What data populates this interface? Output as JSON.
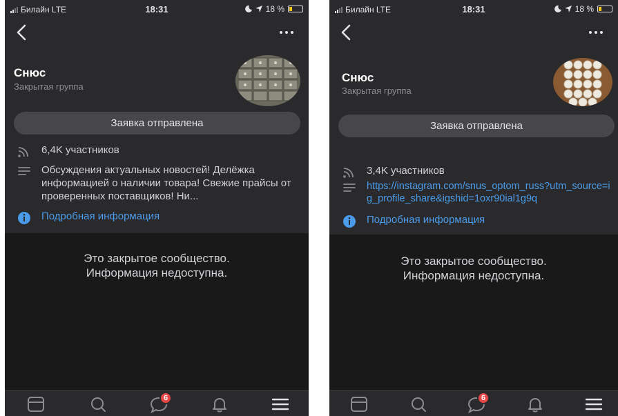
{
  "colors": {
    "background": "#2a2a2c",
    "closed_area": "#19191a",
    "link": "#4a9bea",
    "badge": "#e64646",
    "button": "#474749",
    "battery": "#f5c518"
  },
  "phones": [
    {
      "status": {
        "carrier": "Билайн  LTE",
        "time": "18:31",
        "battery": "18 %",
        "battery_level_percent": 18
      },
      "group": {
        "name": "Снюс",
        "type": "Закрытая группа"
      },
      "request_button": "Заявка отправлена",
      "members": "6,4K участников",
      "description": "Обсуждения актуальных новостей! Делёжка информацией о наличии товара! Свежие прайсы от проверенных поставщиков! Ни...",
      "details_link": "Подробная информация",
      "closed_message": [
        "Это закрытое сообщество.",
        "Информация недоступна."
      ],
      "tabbar": {
        "messages_badge": "6"
      },
      "icons": [
        "back-icon",
        "more-icon",
        "rss-icon",
        "description-icon",
        "info-icon",
        "news-tab-icon",
        "search-tab-icon",
        "messages-tab-icon",
        "notifications-tab-icon",
        "menu-tab-icon"
      ]
    },
    {
      "status": {
        "carrier": "Билайн  LTE",
        "time": "18:31",
        "battery": "18 %",
        "battery_level_percent": 18
      },
      "group": {
        "name": "Снюс",
        "type": "Закрытая группа"
      },
      "request_button": "Заявка отправлена",
      "members": "3,4K участников",
      "link": "https://instagram.com/snus_optom_russ?utm_source=ig_profile_share&igshid=1oxr90ial1g9q",
      "details_link": "Подробная информация",
      "closed_message": [
        "Это закрытое сообщество.",
        "Информация недоступна."
      ],
      "tabbar": {
        "messages_badge": "6"
      },
      "icons": [
        "back-icon",
        "more-icon",
        "rss-icon",
        "link-icon",
        "info-icon",
        "news-tab-icon",
        "search-tab-icon",
        "messages-tab-icon",
        "notifications-tab-icon",
        "menu-tab-icon"
      ]
    }
  ]
}
